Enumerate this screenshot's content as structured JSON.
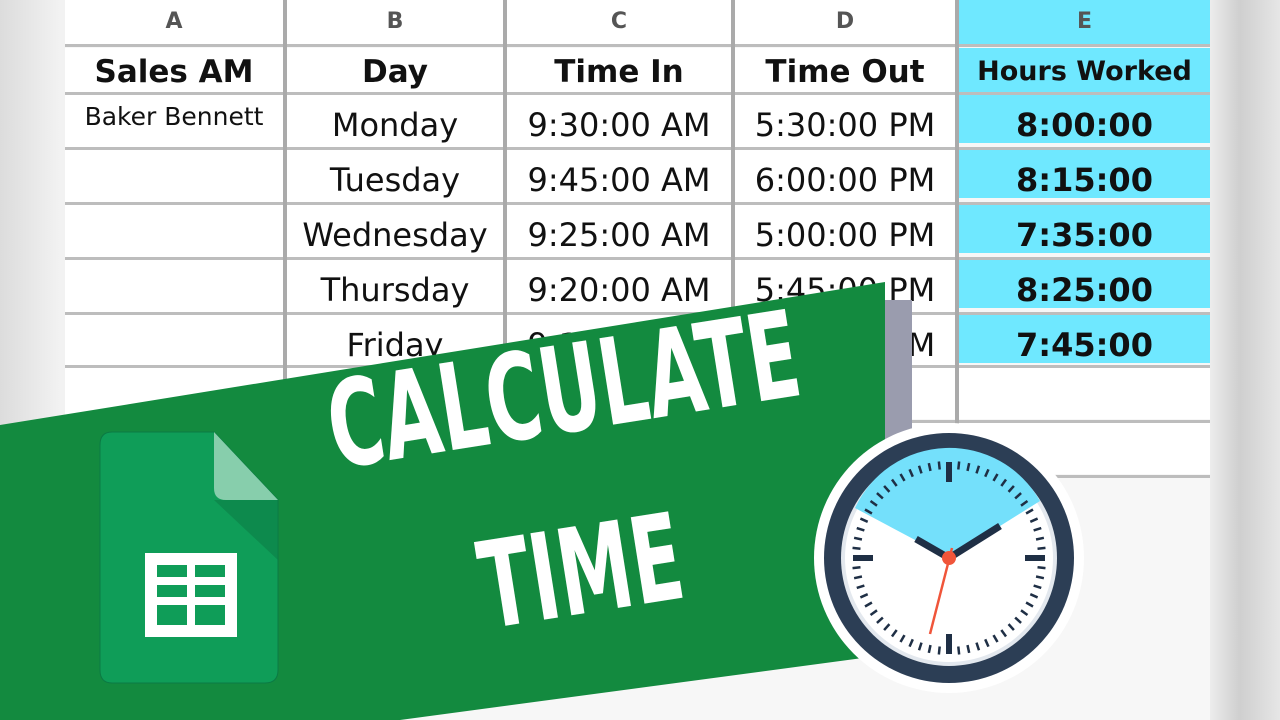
{
  "spreadsheet": {
    "column_letters": [
      "A",
      "B",
      "C",
      "D",
      "E"
    ],
    "headers": [
      "Sales AM",
      "Day",
      "Time In",
      "Time Out",
      "Hours Worked"
    ],
    "rows": [
      {
        "name": "Baker Bennett",
        "day": "Monday",
        "time_in": "9:30:00 AM",
        "time_out": "5:30:00 PM",
        "hours": "8:00:00"
      },
      {
        "name": "",
        "day": "Tuesday",
        "time_in": "9:45:00 AM",
        "time_out": "6:00:00 PM",
        "hours": "8:15:00"
      },
      {
        "name": "",
        "day": "Wednesday",
        "time_in": "9:25:00 AM",
        "time_out": "5:00:00 PM",
        "hours": "7:35:00"
      },
      {
        "name": "",
        "day": "Thursday",
        "time_in": "9:20:00 AM",
        "time_out": "5:45:00 PM",
        "hours": "8:25:00"
      },
      {
        "name": "",
        "day": "Friday",
        "time_in": "9:15:00 AM",
        "time_out": "5:00:00 PM",
        "hours": "7:45:00"
      }
    ],
    "highlight_color": "#6fe8ff"
  },
  "banner": {
    "line1": "CALCULATE",
    "line2": "TIME",
    "color": "#138a3f"
  },
  "icons": {
    "app": "google-sheets-icon",
    "clock": "clock-icon"
  }
}
